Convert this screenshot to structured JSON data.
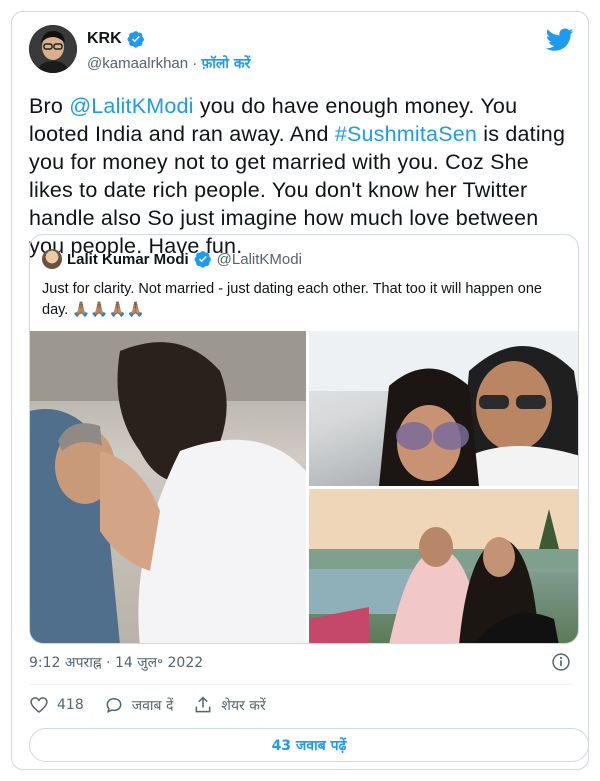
{
  "author": {
    "name": "KRK",
    "handle": "@kamaalrkhan",
    "separator": " · ",
    "follow_label": "फ़ॉलो करें"
  },
  "tweet": {
    "t1": "Bro ",
    "mention": "@LalitKModi",
    "t2": " you do have enough money. You looted India and ran away. And ",
    "hashtag": "#SushmitaSen",
    "t3": " is dating you for money not to get married with you. Coz She likes to date rich people. You don't know her Twitter handle also So just imagine how much love between you people. Have fun."
  },
  "quote": {
    "name": "Lalit Kumar Modi",
    "handle": "@LalitKModi",
    "text": "Just for clarity. Not married - just dating each other. That too it will happen one day. 🙏🏽🙏🏽🙏🏽🙏🏽"
  },
  "meta": {
    "time": "9:12 अपराह्न",
    "separator": " · ",
    "date": "14 जुल॰ 2022"
  },
  "actions": {
    "likes": "418",
    "reply_label": "जवाब दें",
    "share_label": "शेयर करें"
  },
  "read_replies_label": "43 जवाब पढ़ें",
  "colors": {
    "accent": "#1d9bf0",
    "text": "#0f1419",
    "secondary": "#536471",
    "border": "#cfd9de"
  }
}
